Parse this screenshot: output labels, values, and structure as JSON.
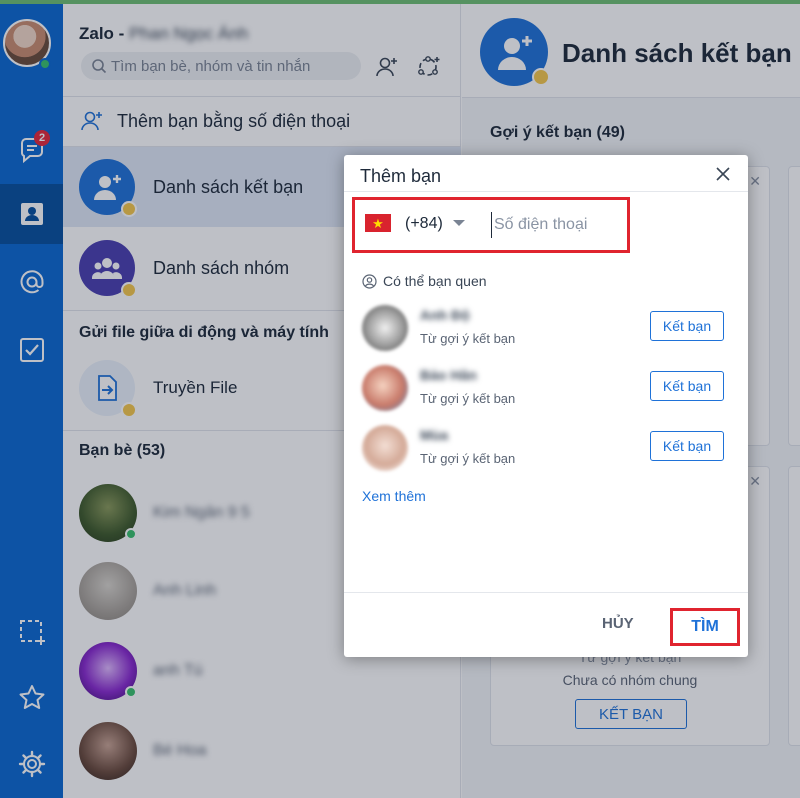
{
  "app": {
    "title": "Zalo -",
    "title_blurred": "Phan Ngọc Ánh"
  },
  "rail": {
    "messages_badge": "2",
    "items": [
      "chat-icon",
      "contacts-icon",
      "mention-icon",
      "todo-icon",
      "screenshot-icon",
      "star-icon",
      "gear-icon"
    ]
  },
  "search": {
    "placeholder": "Tìm bạn bè, nhóm và tin nhắn"
  },
  "sidebar": {
    "add_by_phone": "Thêm bạn bằng số điện thoại",
    "friend_list": "Danh sách kết bạn",
    "group_list": "Danh sách nhóm",
    "file_section": "Gửi file giữa di động và máy tính",
    "transfer_file": "Truyền File",
    "friends_header": "Bạn bè (53)",
    "friends": [
      {
        "name": "Kim Ngân 9 5"
      },
      {
        "name": "Anh Linh"
      },
      {
        "name": "anh Tú"
      },
      {
        "name": "Bé Hoa"
      }
    ]
  },
  "right_panel": {
    "title": "Danh sách kết bạn",
    "suggestions_header": "Gợi ý kết bạn (49)",
    "card_line1": "Từ gợi ý kết bạn",
    "card_line2": "Chưa có nhóm chung",
    "card_button": "KẾT BẠN"
  },
  "dialog": {
    "title": "Thêm bạn",
    "country_code": "(+84)",
    "phone_placeholder": "Số điện thoại",
    "maybe_know": "Có thể bạn quen",
    "suggestions": [
      {
        "name": "Anh Độ",
        "subtitle": "Từ gợi ý kết bạn",
        "button": "Kết bạn"
      },
      {
        "name": "Bảo Hân",
        "subtitle": "Từ gợi ý kết bạn",
        "button": "Kết bạn"
      },
      {
        "name": "Mùa",
        "subtitle": "Từ gợi ý kết bạn",
        "button": "Kết bạn"
      }
    ],
    "see_more": "Xem thêm",
    "cancel": "HỦY",
    "find": "TÌM"
  },
  "colors": {
    "rail": "#0a68d1",
    "accent": "#1f72d8",
    "highlight_box": "#e0242f",
    "online": "#39c16c"
  }
}
